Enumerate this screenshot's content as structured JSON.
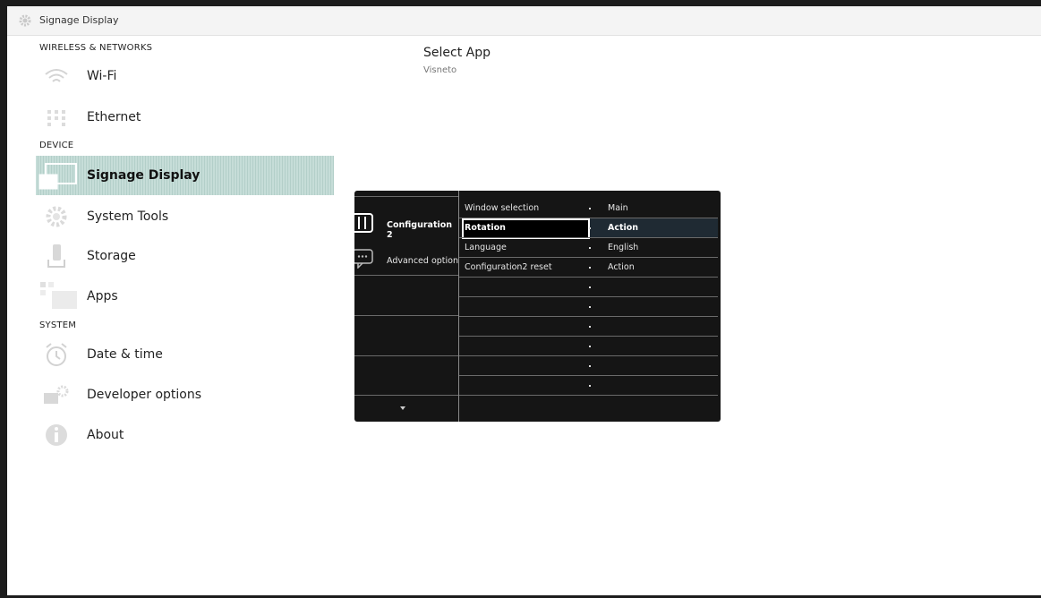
{
  "titlebar": {
    "title": "Signage Display",
    "icon": "gear-icon"
  },
  "sections": {
    "wireless": "WIRELESS & NETWORKS",
    "device": "DEVICE",
    "system": "SYSTEM"
  },
  "nav": {
    "wifi": "Wi-Fi",
    "ethernet": "Ethernet",
    "signage": "Signage Display",
    "tools": "System Tools",
    "storage": "Storage",
    "apps": "Apps",
    "datetime": "Date & time",
    "developer": "Developer options",
    "about": "About"
  },
  "content": {
    "select_app_title": "Select App",
    "select_app_value": "Visneto"
  },
  "osd": {
    "tabs": [
      "Configuration 2",
      "Advanced option"
    ],
    "active_tab": "Configuration 2",
    "rows": [
      {
        "name": "Window selection",
        "value": "Main"
      },
      {
        "name": "Rotation",
        "value": "Action"
      },
      {
        "name": "Language",
        "value": "English"
      },
      {
        "name": "Configuration2 reset",
        "value": "Action"
      }
    ],
    "selected_row": "Rotation",
    "empty_rows": 6
  },
  "colors": {
    "active_nav_bg": "#c6ddd8",
    "osd_bg": "#151515",
    "icon_grey": "#c8c8c8"
  }
}
